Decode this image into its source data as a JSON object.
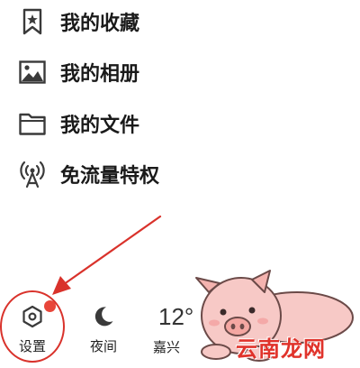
{
  "menu": {
    "items": [
      {
        "label": "我的收藏",
        "icon": "bookmark-star-icon"
      },
      {
        "label": "我的相册",
        "icon": "image-icon"
      },
      {
        "label": "我的文件",
        "icon": "folder-icon"
      },
      {
        "label": "免流量特权",
        "icon": "broadcast-antenna-icon"
      }
    ]
  },
  "toolbar": {
    "settings_label": "设置",
    "night_label": "夜间",
    "weather_temp": "12°",
    "weather_label": "嘉兴"
  },
  "overlay": {
    "watermark": "云南龙网"
  },
  "colors": {
    "annotation_red": "#d9322b",
    "badge_red": "#e8463a",
    "icon_gray": "#3a3a3a",
    "pig_pink": "#f7c9c6"
  }
}
